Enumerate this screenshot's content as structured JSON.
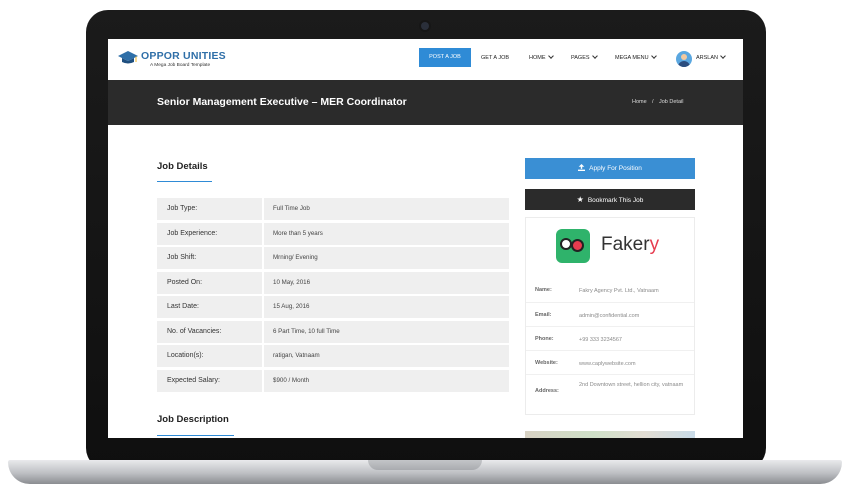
{
  "brand": {
    "title": "OPPOR UNITIES",
    "tagline": "A Mega Job Board Template"
  },
  "nav": {
    "post_job": "POST A JOB",
    "get_job": "GET A JOB",
    "home": "HOME",
    "pages": "PAGES",
    "mega_menu": "MEGA MENU",
    "user": "ARSLAN"
  },
  "banner": {
    "title": "Senior Management Executive – MER Coordinator",
    "breadcrumb_home": "Home",
    "breadcrumb_sep": "/",
    "breadcrumb_current": "Job Detail"
  },
  "job_details": {
    "title": "Job Details",
    "rows": [
      {
        "label": "Job Type:",
        "value": "Full Time Job"
      },
      {
        "label": "Job Experience:",
        "value": "More than 5 years"
      },
      {
        "label": "Job Shift:",
        "value": "Mrning/ Evening"
      },
      {
        "label": "Posted On:",
        "value": "10 May, 2016"
      },
      {
        "label": "Last Date:",
        "value": "15 Aug, 2016"
      },
      {
        "label": "No. of Vacancies:",
        "value": "6 Part Time, 10 full Time"
      },
      {
        "label": "Location(s):",
        "value": "ratigan, Vatnaam"
      },
      {
        "label": "Expected Salary:",
        "value": "$900 / Month"
      }
    ]
  },
  "job_description": {
    "title": "Job Description"
  },
  "actions": {
    "apply": "Apply For Position",
    "bookmark": "Bookmark This Job"
  },
  "company": {
    "name_main": "Faker",
    "name_accent": "y",
    "rows": [
      {
        "label": "Name:",
        "value": "Fakry Agency Pvt. Ltd., Vatnaam"
      },
      {
        "label": "Email:",
        "value": "admin@confidential.com"
      },
      {
        "label": "Phone:",
        "value": "+99 333 3234567"
      },
      {
        "label": "Website:",
        "value": "www.caplywebsite.com"
      },
      {
        "label": "Address:",
        "value": "2nd Downtown street, hellion city, vatnaam"
      }
    ]
  },
  "colors": {
    "accent": "#2f8bd6",
    "dark": "#2b2b2b",
    "brand_green": "#2fb36b",
    "brand_red": "#e63c4f"
  }
}
